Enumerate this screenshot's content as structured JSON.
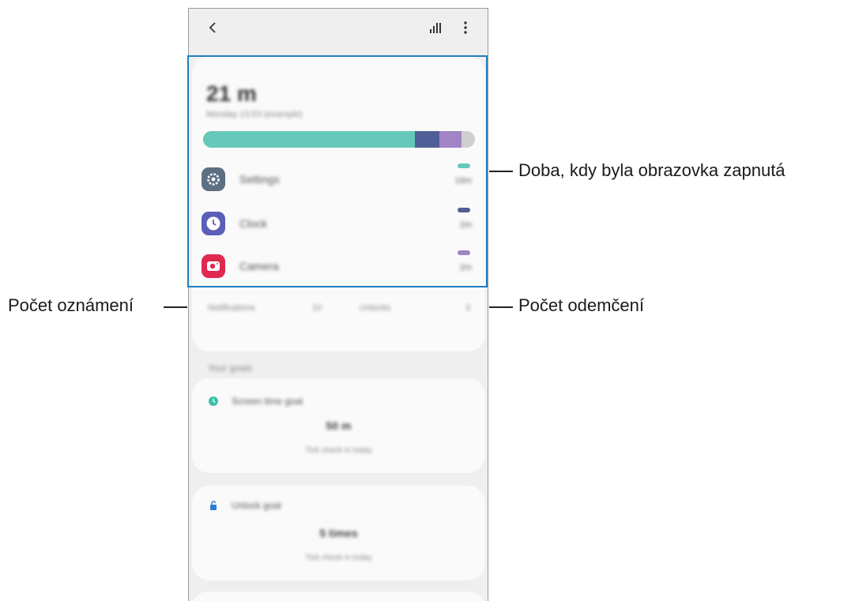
{
  "callouts": {
    "screen_time": "Doba, kdy byla obrazovka zapnutá",
    "notifications": "Počet oznámení",
    "unlocks": "Počet odemčení"
  },
  "icons": {
    "back": "chevron-left-icon",
    "stats": "bar-chart-icon",
    "more": "more-vert-icon"
  },
  "usage": {
    "total_time": "21 m",
    "date": "Monday 13:53 (example)",
    "bar_segments": [
      {
        "app": "Settings",
        "fraction": 0.78,
        "color": "#66c8b8"
      },
      {
        "app": "Clock",
        "fraction": 0.09,
        "color": "#4f5e96"
      },
      {
        "app": "Camera",
        "fraction": 0.08,
        "color": "#a084c4"
      },
      {
        "app": "other",
        "fraction": 0.05,
        "color": "#cfcfcf"
      }
    ],
    "apps": [
      {
        "name": "Settings",
        "time": "16m",
        "color": "#66c8b8",
        "icon_color": "#5d6f82"
      },
      {
        "name": "Clock",
        "time": "2m",
        "color": "#4f5e96",
        "icon_color": "#5b5fb8"
      },
      {
        "name": "Camera",
        "time": "2m",
        "color": "#a084c4",
        "icon_color": "#e0294f"
      }
    ],
    "notifications_label": "Notifications",
    "notifications_count": "10",
    "unlocks_label": "Unlocks",
    "unlocks_count": "3"
  },
  "goals": {
    "section_title": "Your goals",
    "screen_goal": {
      "title": "Screen time goal",
      "value": "50 m",
      "sub": "Tick check in today"
    },
    "unlock_goal": {
      "title": "Unlock goal",
      "value": "5 times",
      "sub": "Tick check in today"
    }
  }
}
